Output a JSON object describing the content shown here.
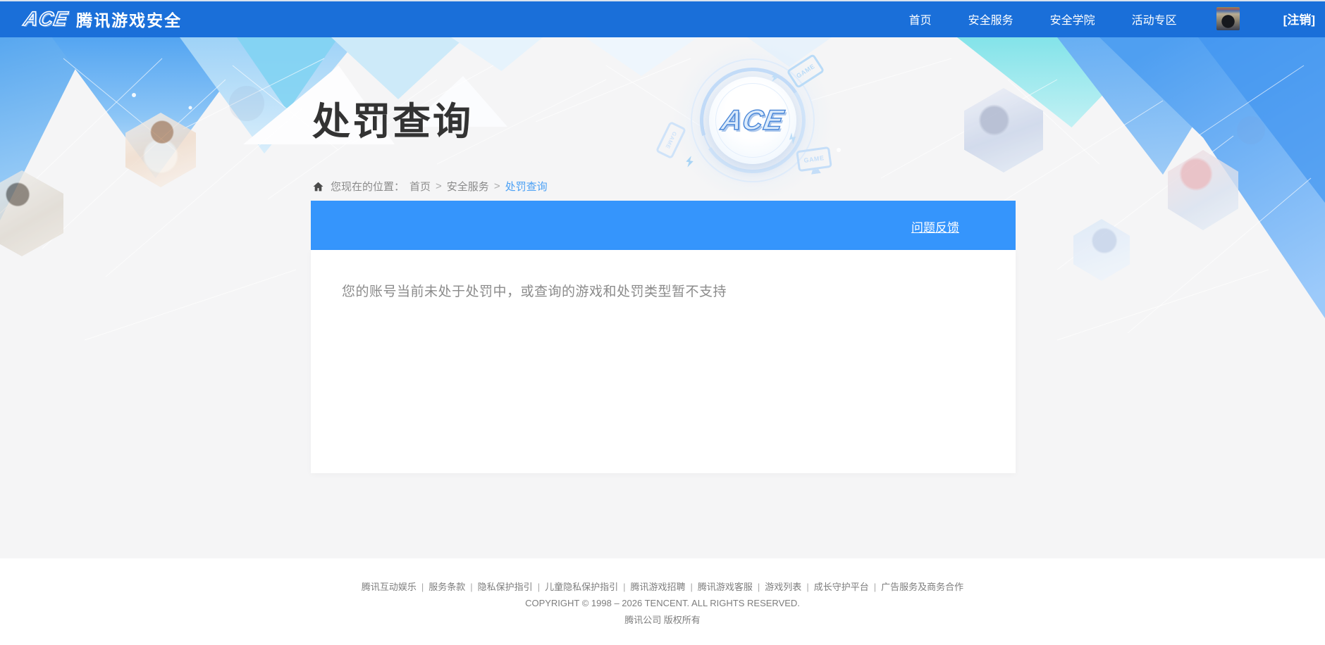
{
  "navbar": {
    "logo_text": "ACE",
    "brand_title": "腾讯游戏安全",
    "items": [
      {
        "label": "首页"
      },
      {
        "label": "安全服务"
      },
      {
        "label": "安全学院"
      },
      {
        "label": "活动专区"
      }
    ],
    "logout_label": "[注销]"
  },
  "hero": {
    "page_title": "处罚查询",
    "breadcrumb": {
      "prefix": "您现在的位置：",
      "separator": ">",
      "items": [
        "首页",
        "安全服务",
        "处罚查询"
      ]
    },
    "emblem": {
      "logo_text": "ACE",
      "game_label": "GAME"
    }
  },
  "panel": {
    "feedback_link": "问题反馈",
    "message": "您的账号当前未处于处罚中，或查询的游戏和处罚类型暂不支持"
  },
  "footer": {
    "separator": "|",
    "links": [
      "腾讯互动娱乐",
      "服务条款",
      "隐私保护指引",
      "儿童隐私保护指引",
      "腾讯游戏招聘",
      "腾讯游戏客服",
      "游戏列表",
      "成长守护平台",
      "广告服务及商务合作"
    ],
    "copyright": "COPYRIGHT © 1998 – 2026 TENCENT. ALL RIGHTS RESERVED.",
    "company": "腾讯公司 版权所有"
  },
  "colors": {
    "navbar_blue": "#1A6FD9",
    "banner_blue": "#3595FC",
    "breadcrumb_active_blue": "#4AA0F5",
    "title_text": "#333333",
    "message_text": "#8B8B8B"
  }
}
